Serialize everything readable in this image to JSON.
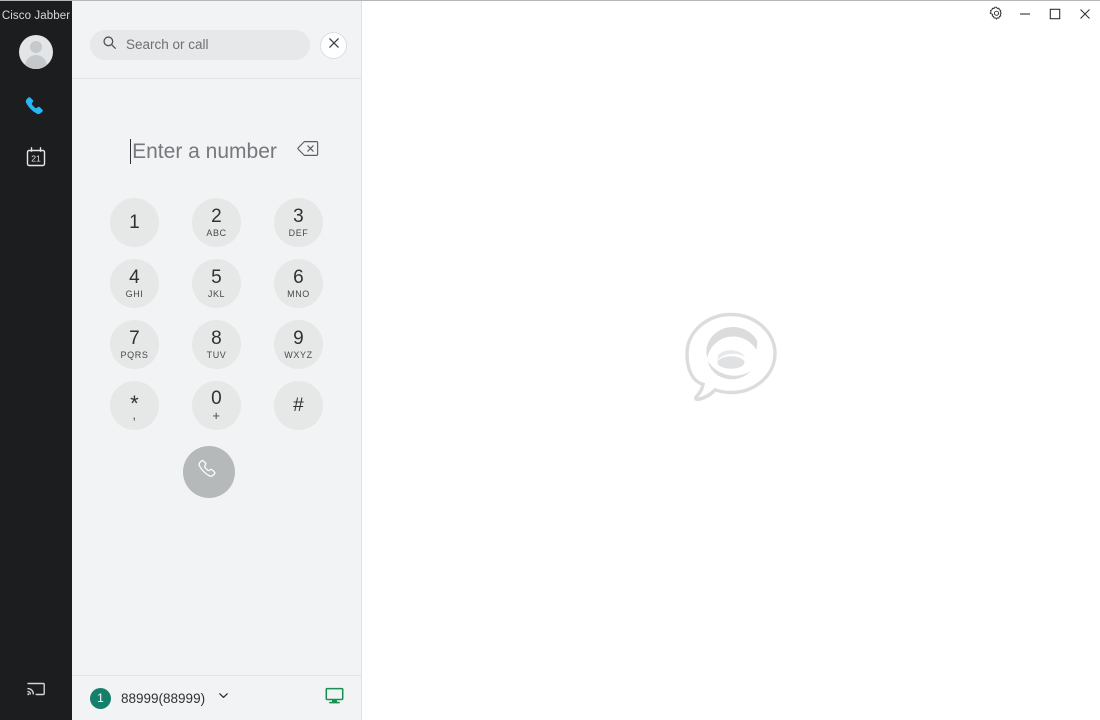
{
  "app": {
    "title": "Cisco Jabber",
    "accent_blue": "#29b6f6",
    "panel_bg": "#f1f3f4",
    "rail_bg": "#1b1d1f",
    "badge_color": "#157f6b",
    "device_icon_color": "#17914f"
  },
  "rail": {
    "title": "Cisco Jabber",
    "avatar_name": "user-avatar",
    "items": [
      {
        "id": "calls",
        "label": "Calls",
        "icon": "phone-icon",
        "active": true
      },
      {
        "id": "meetings",
        "label": "Meetings",
        "icon": "calendar-icon",
        "day": "21",
        "active": false
      }
    ],
    "bottom_item": {
      "id": "share",
      "label": "Share screen",
      "icon": "screen-cast-icon"
    }
  },
  "search": {
    "placeholder": "Search or call",
    "value": "",
    "icon": "search-icon",
    "close_label": "Close"
  },
  "dialpad": {
    "number_placeholder": "Enter a number",
    "number_value": "",
    "backspace_label": "Backspace",
    "call_label": "Call",
    "call_enabled": false,
    "keys": [
      {
        "digit": "1",
        "letters": ""
      },
      {
        "digit": "2",
        "letters": "ABC"
      },
      {
        "digit": "3",
        "letters": "DEF"
      },
      {
        "digit": "4",
        "letters": "GHI"
      },
      {
        "digit": "5",
        "letters": "JKL"
      },
      {
        "digit": "6",
        "letters": "MNO"
      },
      {
        "digit": "7",
        "letters": "PQRS"
      },
      {
        "digit": "8",
        "letters": "TUV"
      },
      {
        "digit": "9",
        "letters": "WXYZ"
      },
      {
        "digit": "*",
        "letters": ","
      },
      {
        "digit": "0",
        "letters": "+"
      },
      {
        "digit": "#",
        "letters": ""
      }
    ]
  },
  "statusbar": {
    "badge_count": "1",
    "line_number": "88999(88999)",
    "dropdown_icon": "chevron-down-icon",
    "device_icon": "monitor-icon"
  },
  "window": {
    "settings_label": "Settings",
    "minimize_label": "Minimize",
    "maximize_label": "Maximize",
    "close_label": "Close"
  },
  "main": {
    "watermark": "jabber-logo-watermark"
  }
}
